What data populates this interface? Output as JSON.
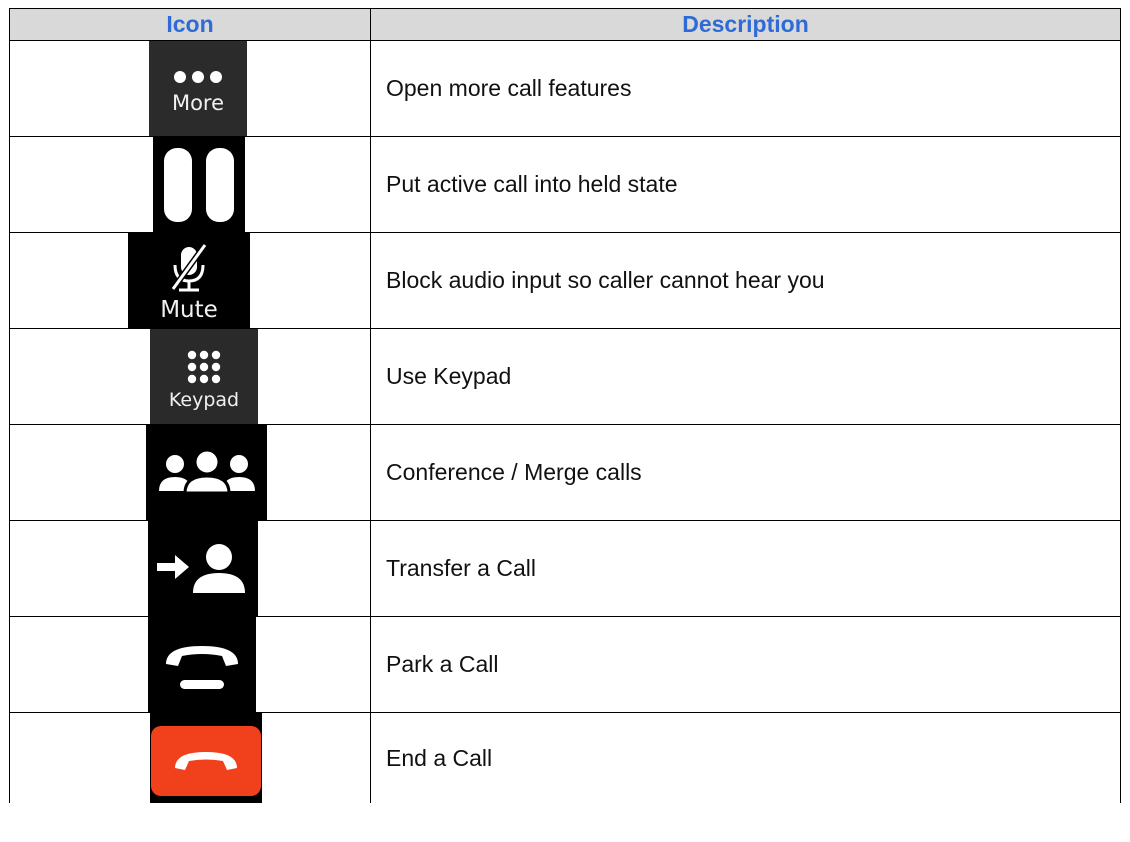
{
  "table": {
    "headers": {
      "icon": "Icon",
      "description": "Description"
    },
    "rows": [
      {
        "icon_name": "more-icon",
        "icon_label": "More",
        "description": "Open more call features"
      },
      {
        "icon_name": "hold-icon",
        "icon_label": "",
        "description": "Put active call into held state"
      },
      {
        "icon_name": "mute-icon",
        "icon_label": "Mute",
        "description": "Block audio input so caller cannot hear you"
      },
      {
        "icon_name": "keypad-icon",
        "icon_label": "Keypad",
        "description": "Use Keypad"
      },
      {
        "icon_name": "conference-icon",
        "icon_label": "",
        "description": "Conference / Merge calls"
      },
      {
        "icon_name": "transfer-icon",
        "icon_label": "",
        "description": "Transfer a Call"
      },
      {
        "icon_name": "park-icon",
        "icon_label": "",
        "description": "Park a Call"
      },
      {
        "icon_name": "end-call-icon",
        "icon_label": "",
        "description": "End a Call"
      }
    ]
  },
  "colors": {
    "header_text": "#2f6bd6",
    "header_bg": "#d9d9d9",
    "end_call_red": "#f1401c"
  }
}
